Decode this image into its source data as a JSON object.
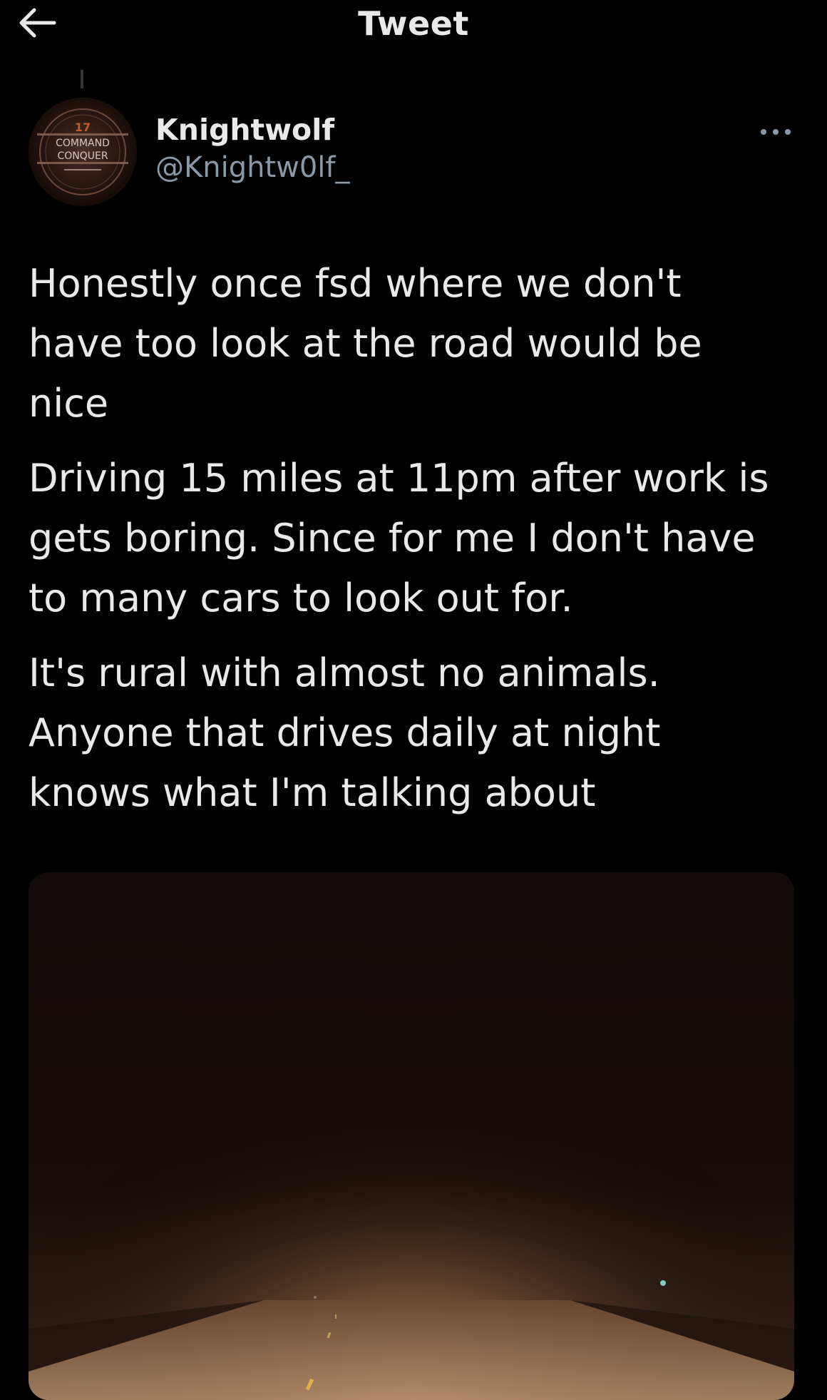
{
  "header": {
    "title": "Tweet",
    "back_icon": "arrow-left-icon"
  },
  "author": {
    "name": "Knightwolf",
    "handle": "@Knightw0lf_",
    "avatar": {
      "badge_number": "17",
      "line1": "COMMAND",
      "line2": "CONQUER"
    }
  },
  "tweet": {
    "paragraphs": [
      "Honestly once fsd where we don't\nhave too look at the road would be\nnice",
      "Driving 15 miles at 11pm after work is\ngets boring. Since for me I don't have\nto many cars to look out for.",
      "It's rural with almost no animals.\nAnyone that drives daily at night\nknows what I'm talking about"
    ],
    "more_icon": "more-horizontal-icon"
  },
  "colors": {
    "background": "#000000",
    "text_primary": "#e7e9ea",
    "text_secondary": "#8b98a5"
  }
}
